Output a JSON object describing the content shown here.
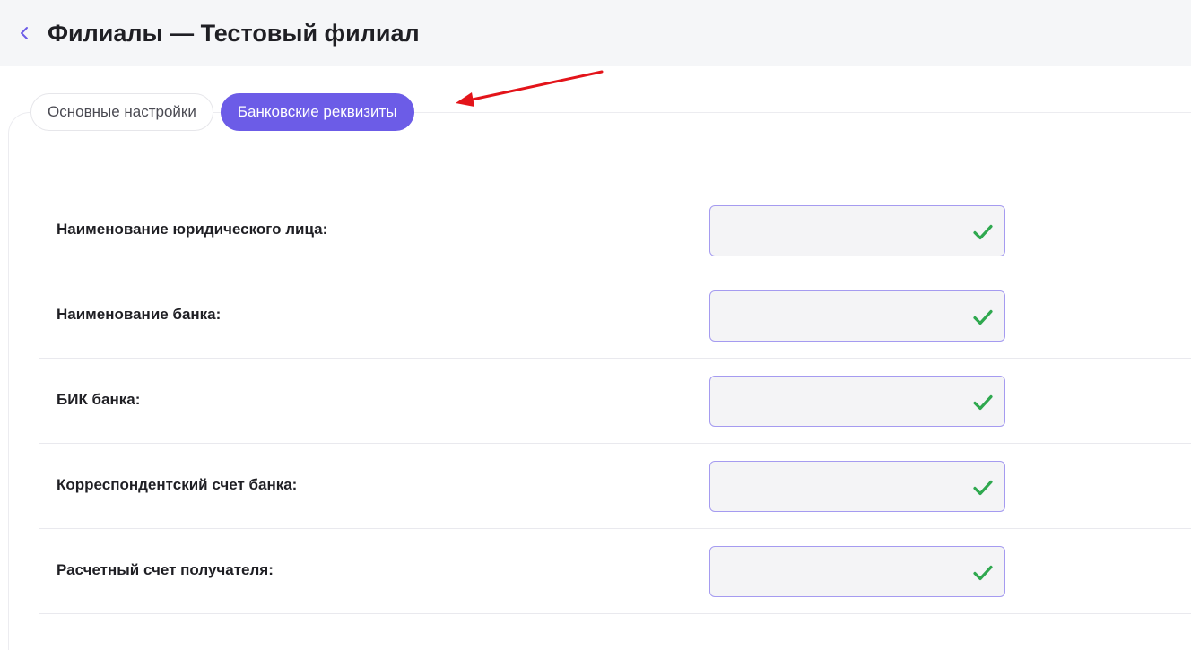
{
  "header": {
    "back_icon": "chevron-left-icon",
    "title": "Филиалы — Тестовый филиал"
  },
  "tabs": [
    {
      "label": "Основные настройки",
      "active": false
    },
    {
      "label": "Банковские реквизиты",
      "active": true
    }
  ],
  "form": {
    "fields": [
      {
        "label": "Наименование юридического лица:",
        "value": "",
        "status_icon": "check-icon"
      },
      {
        "label": "Наименование банка:",
        "value": "",
        "status_icon": "check-icon"
      },
      {
        "label": "БИК банка:",
        "value": "",
        "status_icon": "check-icon"
      },
      {
        "label": "Корреспондентский счет банка:",
        "value": "",
        "status_icon": "check-icon"
      },
      {
        "label": "Расчетный счет получателя:",
        "value": "",
        "status_icon": "check-icon"
      }
    ]
  },
  "colors": {
    "accent": "#6c5ce7",
    "valid": "#2fa84f",
    "annotation_arrow": "#e3141a",
    "header_bg": "#f5f6f8"
  }
}
